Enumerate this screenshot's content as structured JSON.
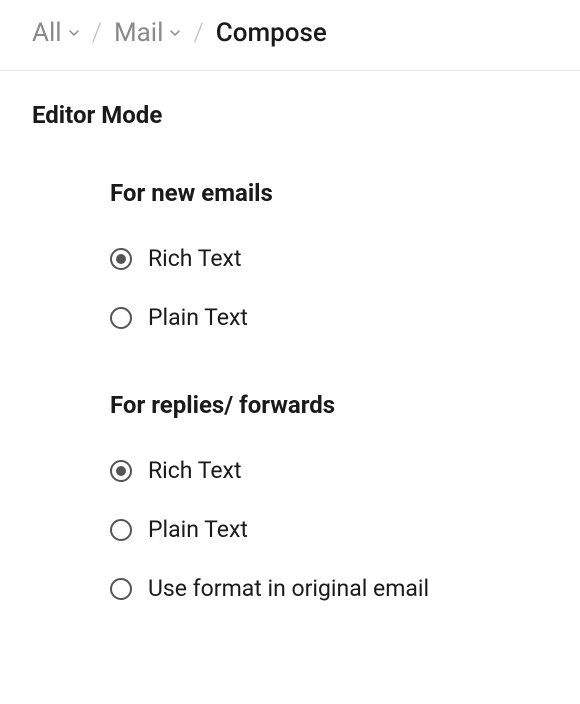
{
  "breadcrumb": {
    "item1": "All",
    "item2": "Mail",
    "item3": "Compose"
  },
  "section": {
    "title": "Editor Mode"
  },
  "group1": {
    "title": "For new emails",
    "options": [
      {
        "label": "Rich Text",
        "selected": true
      },
      {
        "label": "Plain Text",
        "selected": false
      }
    ]
  },
  "group2": {
    "title": "For replies/ forwards",
    "options": [
      {
        "label": "Rich Text",
        "selected": true
      },
      {
        "label": "Plain Text",
        "selected": false
      },
      {
        "label": "Use format in original email",
        "selected": false
      }
    ]
  }
}
